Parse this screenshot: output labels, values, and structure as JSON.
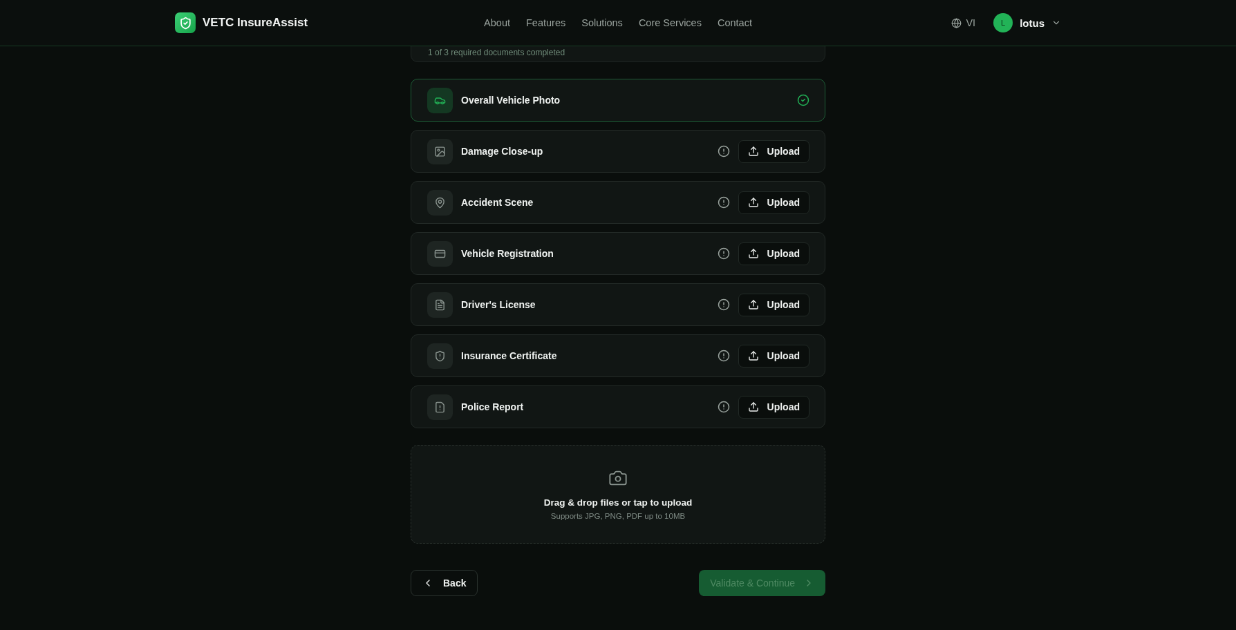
{
  "header": {
    "brand": "VETC InsureAssist",
    "nav": [
      {
        "label": "About"
      },
      {
        "label": "Features"
      },
      {
        "label": "Solutions"
      },
      {
        "label": "Core Services"
      },
      {
        "label": "Contact"
      }
    ],
    "language": "VI",
    "user": {
      "initial": "L",
      "name": "lotus"
    }
  },
  "progress": {
    "text": "1 of 3 required documents completed"
  },
  "documents": [
    {
      "name": "Overall Vehicle Photo",
      "uploaded": true
    },
    {
      "name": "Damage Close-up",
      "uploaded": false,
      "action": "Upload"
    },
    {
      "name": "Accident Scene",
      "uploaded": false,
      "action": "Upload"
    },
    {
      "name": "Vehicle Registration",
      "uploaded": false,
      "action": "Upload"
    },
    {
      "name": "Driver's License",
      "uploaded": false,
      "action": "Upload"
    },
    {
      "name": "Insurance Certificate",
      "uploaded": false,
      "action": "Upload"
    },
    {
      "name": "Police Report",
      "uploaded": false,
      "action": "Upload"
    }
  ],
  "dropzone": {
    "title": "Drag & drop files or tap to upload",
    "hint": "Supports JPG, PNG, PDF up to 10MB"
  },
  "footer": {
    "back": "Back",
    "next": {
      "label": "Validate & Continue",
      "disabled": true
    }
  }
}
